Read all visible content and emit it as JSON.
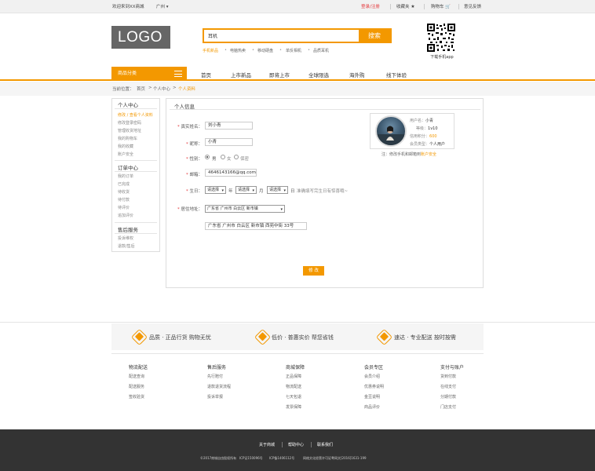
{
  "topbar": {
    "welcome": "欢迎来到XX商城",
    "city": "广州",
    "login_register": "登录/注册",
    "favorites": "收藏夹",
    "cart": "购物车",
    "feedback": "意见反馈"
  },
  "header": {
    "logo": "LOGO",
    "search_value": "耳机",
    "search_button": "搜索",
    "hot_words": [
      "手机新品",
      "电脑热卖",
      "移动硬盘",
      "单反相机",
      "品质耳机"
    ],
    "qr_caption": "下载手机app"
  },
  "nav": {
    "category": "商品分类",
    "items": [
      "首页",
      "上市新品",
      "即将上市",
      "全球限选",
      "海外购",
      "线下体验"
    ]
  },
  "breadcrumb": {
    "prefix": "当前位置：",
    "items": [
      "首页",
      "个人中心",
      "个人资料"
    ],
    "sep": ">"
  },
  "sidebar": {
    "sections": [
      {
        "title": "个人中心",
        "items": [
          "修改 / 查看个人资料",
          "修改登录密码",
          "管理收货地址",
          "我的购物车",
          "我的收藏",
          "账户安全"
        ]
      },
      {
        "title": "订单中心",
        "items": [
          "我的订单",
          "已完成",
          "待收货",
          "待付款",
          "待评价",
          "追加评价"
        ]
      },
      {
        "title": "售后服务",
        "items": [
          "投诉维权",
          "退款/售后"
        ]
      }
    ]
  },
  "profile": {
    "title": "个人信息",
    "real_name_label": "真实姓名：",
    "real_name": "刘小青",
    "nickname_label": "昵称：",
    "nickname": "小青",
    "gender_label": "性别：",
    "gender_options": [
      "男",
      "女",
      "保密"
    ],
    "email_label": "邮箱：",
    "email": "4646143166@qq.com",
    "birthday_label": "生日：",
    "birth_year": "请选择",
    "year_unit": "年",
    "birth_month": "请选择",
    "month_unit": "月",
    "birth_day": "请选择",
    "day_unit": "日",
    "birthday_hint": "准确填写完生日有惊喜哦~",
    "address_label": "居住地址：",
    "address_select": "广东省 广州市 白云区 新市镇",
    "address_detail": "广东省 广州市 白云区 新市镇 西苑中街 33号",
    "submit": "修 改"
  },
  "user_card": {
    "username_label": "用户名：",
    "username": "小青",
    "level_label": "等级：",
    "level": "1v10",
    "credit_label": "信用积分：",
    "credit": "600",
    "type_label": "会员类型：",
    "type": "个人用户",
    "note_prefix": "注：修改手机和邮箱到",
    "note_link": "账户安全"
  },
  "guarantee": [
    {
      "icon": "quality-icon",
      "text": "品质 · 正品行货 购物无忧"
    },
    {
      "icon": "price-icon",
      "text": "低价 · 普惠实价 帮您省钱"
    },
    {
      "icon": "delivery-icon",
      "text": "速达 · 专业配送 按时按需"
    }
  ],
  "footer_columns": [
    {
      "title": "物流配送",
      "items": [
        "配送查询",
        "配送服务",
        "签收验货"
      ]
    },
    {
      "title": "售后服务",
      "items": [
        "先行赔付",
        "退款退货流程",
        "投诉举报"
      ]
    },
    {
      "title": "商城保障",
      "items": [
        "正品保障",
        "物流配送",
        "七天包退",
        "发票保障"
      ]
    },
    {
      "title": "会员专区",
      "items": [
        "会员介绍",
        "优惠券说明",
        "金豆说明",
        "商品评价"
      ]
    },
    {
      "title": "支付与账户",
      "items": [
        "货到付款",
        "在线支付",
        "分期付款",
        "门店支付"
      ]
    }
  ],
  "footer": {
    "links": [
      "关于商城",
      "帮助中心",
      "联系我们"
    ],
    "copyright": "©2017商城自由股权所有",
    "icp1": "ICP证150096号",
    "icp2": "ICP备1406112号",
    "license": "网络文化经营许可证粤网文[2016]1631-199"
  },
  "colors": {
    "accent": "#f39800",
    "footer_bg": "#333333"
  }
}
